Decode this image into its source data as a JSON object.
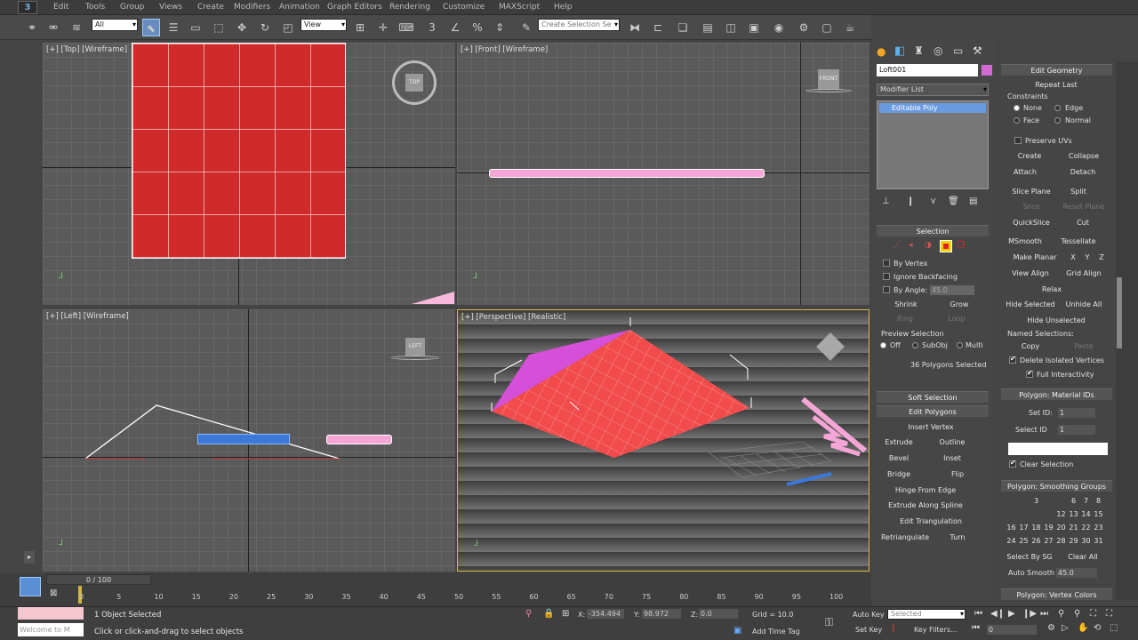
{
  "menubar": {
    "items": [
      "Edit",
      "Tools",
      "Group",
      "Views",
      "Create",
      "Modifiers",
      "Animation",
      "Graph Editors",
      "Rendering",
      "Customize",
      "MAXScript",
      "Help"
    ]
  },
  "toolbar": {
    "filter_value": "All",
    "view_value": "View",
    "selection_set_placeholder": "Create Selection Se"
  },
  "viewports": {
    "top": "[+] [Top] [Wireframe]",
    "front": "[+] [Front] [Wireframe]",
    "left": "[+] [Left] [Wireframe]",
    "perspective": "[+] [Perspective] [Realistic]"
  },
  "command_panel": {
    "object_name": "Loft001",
    "object_color": "#d36ad6",
    "modifier_list": "Modifier List",
    "stack_item": "Editable Poly",
    "selection_header": "Selection",
    "by_vertex": "By Vertex",
    "ignore_backfacing": "Ignore Backfacing",
    "by_angle": "By Angle:",
    "by_angle_value": "45.0",
    "shrink": "Shrink",
    "grow": "Grow",
    "ring": "Ring",
    "loop": "Loop",
    "preview_selection": "Preview Selection",
    "preview_off": "Off",
    "preview_subobj": "SubObj",
    "preview_multi": "Multi",
    "selection_status": "36 Polygons Selected",
    "soft_selection": "Soft Selection",
    "edit_polygons": "Edit Polygons",
    "insert_vertex": "Insert Vertex",
    "extrude": "Extrude",
    "outline": "Outline",
    "bevel": "Bevel",
    "inset": "Inset",
    "bridge": "Bridge",
    "flip": "Flip",
    "hinge": "Hinge From Edge",
    "extrude_spline": "Extrude Along Spline",
    "edit_tri": "Edit Triangulation",
    "retriangulate": "Retriangulate",
    "turn": "Turn"
  },
  "edit_geometry": {
    "header": "Edit Geometry",
    "repeat_last": "Repeat Last",
    "constraints": "Constraints",
    "none": "None",
    "edge": "Edge",
    "face": "Face",
    "normal": "Normal",
    "preserve_uvs": "Preserve UVs",
    "create": "Create",
    "collapse": "Collapse",
    "attach": "Attach",
    "detach": "Detach",
    "slice_plane": "Slice Plane",
    "split": "Split",
    "slice": "Slice",
    "reset_plane": "Reset Plane",
    "quickslice": "QuickSlice",
    "cut": "Cut",
    "msmooth": "MSmooth",
    "tessellate": "Tessellate",
    "make_planar": "Make Planar",
    "x": "X",
    "y": "Y",
    "z": "Z",
    "view_align": "View Align",
    "grid_align": "Grid Align",
    "relax": "Relax",
    "hide_selected": "Hide Selected",
    "unhide_all": "Unhide All",
    "hide_unselected": "Hide Unselected",
    "named_selections": "Named Selections:",
    "copy": "Copy",
    "paste": "Paste",
    "delete_isolated": "Delete Isolated Vertices",
    "full_interactivity": "Full Interactivity",
    "material_ids_header": "Polygon: Material IDs",
    "set_id": "Set ID:",
    "set_id_value": "1",
    "select_id": "Select ID",
    "select_id_value": "1",
    "clear_selection": "Clear Selection",
    "smoothing_header": "Polygon: Smoothing Groups",
    "smoothing_groups": [
      "",
      "",
      "3",
      "",
      "",
      "6",
      "7",
      "8",
      "",
      "",
      "",
      "",
      "12",
      "13",
      "14",
      "15",
      "16",
      "17",
      "18",
      "19",
      "20",
      "21",
      "22",
      "23",
      "24",
      "25",
      "26",
      "27",
      "28",
      "29",
      "30",
      "31",
      "32"
    ],
    "select_by_sg": "Select By SG",
    "clear_all": "Clear All",
    "auto_smooth": "Auto Smooth",
    "auto_smooth_value": "45.0",
    "vertex_colors_header": "Polygon: Vertex Colors"
  },
  "timeline": {
    "frame": "0 / 100",
    "ticks": [
      "0",
      "5",
      "10",
      "15",
      "20",
      "25",
      "30",
      "35",
      "40",
      "45",
      "50",
      "55",
      "60",
      "65",
      "70",
      "75",
      "80",
      "85",
      "90",
      "95",
      "100"
    ]
  },
  "status": {
    "welcome": "Welcome to M",
    "objects_selected": "1 Object Selected",
    "prompt": "Click or click-and-drag to select objects",
    "x_label": "X:",
    "x_value": "-354.494",
    "y_label": "Y:",
    "y_value": "98.972",
    "z_label": "Z:",
    "z_value": "0.0",
    "grid": "Grid = 10.0",
    "add_time_tag": "Add Time Tag",
    "auto_key": "Auto Key",
    "set_key": "Set Key",
    "selected": "Selected",
    "key_filters": "Key Filters...",
    "frame_value": "0"
  }
}
